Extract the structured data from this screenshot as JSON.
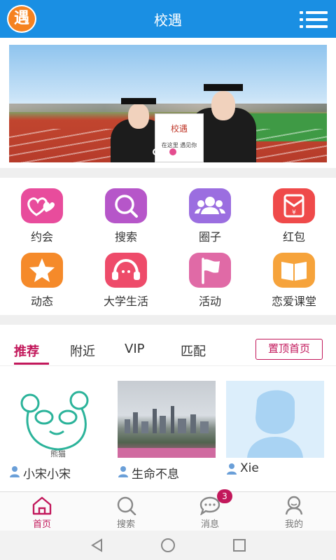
{
  "app": {
    "title": "校遇",
    "logo_char": "遇"
  },
  "banner": {
    "sign_title": "校遇",
    "sign_subtitle": "在这里 遇见你",
    "dots": [
      false,
      true,
      false
    ]
  },
  "features": [
    {
      "label": "约会",
      "icon": "hearts-icon",
      "color": "#e84c9c"
    },
    {
      "label": "搜索",
      "icon": "search-icon",
      "color": "#b656c9"
    },
    {
      "label": "圈子",
      "icon": "group-icon",
      "color": "#9b6ee0"
    },
    {
      "label": "红包",
      "icon": "red-envelope-icon",
      "color": "#ef4a4a"
    },
    {
      "label": "动态",
      "icon": "star-icon",
      "color": "#f58a2a"
    },
    {
      "label": "大学生活",
      "icon": "headset-icon",
      "color": "#ee4b6a"
    },
    {
      "label": "活动",
      "icon": "flag-icon",
      "color": "#e06aa6"
    },
    {
      "label": "恋爱课堂",
      "icon": "book-icon",
      "color": "#f6a33b"
    }
  ],
  "feed": {
    "tabs": [
      "推荐",
      "附近",
      "VIP",
      "匹配"
    ],
    "active_tab": 0,
    "pin_button": "置顶首页",
    "cards": [
      {
        "name": "小宋小宋",
        "image": "panda-drawing",
        "image_caption": "熊猫"
      },
      {
        "name": "生命不息",
        "image": "city-skyline"
      },
      {
        "name": "Xie",
        "image": "default-avatar"
      }
    ]
  },
  "bottom_nav": [
    {
      "label": "首页",
      "icon": "home-icon",
      "active": true
    },
    {
      "label": "搜索",
      "icon": "search-icon",
      "active": false
    },
    {
      "label": "消息",
      "icon": "chat-icon",
      "active": false,
      "badge": "3"
    },
    {
      "label": "我的",
      "icon": "profile-icon",
      "active": false
    }
  ],
  "colors": {
    "primary": "#1a8fe3",
    "accent": "#c2185b",
    "logo": "#f58220"
  }
}
